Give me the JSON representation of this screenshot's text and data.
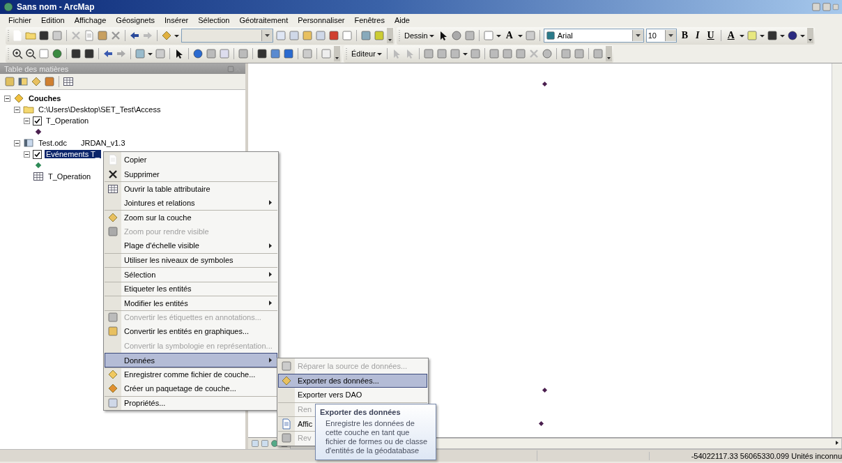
{
  "window": {
    "title": "Sans nom - ArcMap"
  },
  "menu_bar": [
    "Fichier",
    "Edition",
    "Affichage",
    "Géosignets",
    "Insérer",
    "Sélection",
    "Géotraitement",
    "Personnaliser",
    "Fenêtres",
    "Aide"
  ],
  "toolbar_1": {
    "drawing_button": "Dessin",
    "font": "Arial",
    "font_size": "10",
    "bold": "B",
    "italic": "I",
    "underline": "U",
    "font_color": "A",
    "text_tool": "A"
  },
  "toolbar_2": {
    "editor_button": "Éditeur"
  },
  "toc": {
    "title": "Table des matières",
    "tree": [
      {
        "label": "Couches",
        "kind": "frame",
        "expanded": true,
        "children": [
          {
            "label": "C:\\Users\\Desktop\\SET_Test\\Access",
            "kind": "folder",
            "expanded": true,
            "children": [
              {
                "label": "T_Operation",
                "kind": "layer",
                "expanded": true,
                "checked": true,
                "selected": false,
                "children": [
                  {
                    "kind": "symbol",
                    "color": "#4b1f4f"
                  }
                ]
              }
            ]
          },
          {
            "label": "Test.odc",
            "note": "JRDAN_v1.3",
            "kind": "database",
            "expanded": true,
            "children": [
              {
                "label": "Evénements T_",
                "kind": "layer",
                "expanded": true,
                "checked": true,
                "selected": true,
                "children": [
                  {
                    "kind": "symbol",
                    "color": "#2e8b57"
                  }
                ]
              },
              {
                "label": "T_Operation",
                "kind": "table"
              }
            ]
          }
        ]
      }
    ]
  },
  "context_menu": [
    {
      "label": "Copier",
      "disabled": false,
      "submenu": false,
      "selected": false,
      "separator_before": false
    },
    {
      "label": "Supprimer",
      "disabled": false,
      "submenu": false,
      "selected": false,
      "separator_before": false
    },
    {
      "label": "Ouvrir la table attributaire",
      "disabled": false,
      "submenu": false,
      "selected": false,
      "separator_before": true
    },
    {
      "label": "Jointures et relations",
      "disabled": false,
      "submenu": true,
      "selected": false,
      "separator_before": false
    },
    {
      "label": "Zoom sur la couche",
      "disabled": false,
      "submenu": false,
      "selected": false,
      "separator_before": true
    },
    {
      "label": "Zoom pour rendre visible",
      "disabled": true,
      "submenu": false,
      "selected": false,
      "separator_before": false
    },
    {
      "label": "Plage d'échelle visible",
      "disabled": false,
      "submenu": true,
      "selected": false,
      "separator_before": false
    },
    {
      "label": "Utiliser les niveaux de symboles",
      "disabled": false,
      "submenu": false,
      "selected": false,
      "separator_before": true
    },
    {
      "label": "Sélection",
      "disabled": false,
      "submenu": true,
      "selected": false,
      "separator_before": true
    },
    {
      "label": "Etiqueter les entités",
      "disabled": false,
      "submenu": false,
      "selected": false,
      "separator_before": true
    },
    {
      "label": "Modifier les entités",
      "disabled": false,
      "submenu": true,
      "selected": false,
      "separator_before": true
    },
    {
      "label": "Convertir les étiquettes en annotations...",
      "disabled": true,
      "submenu": false,
      "selected": false,
      "separator_before": true
    },
    {
      "label": "Convertir les entités en graphiques...",
      "disabled": false,
      "submenu": false,
      "selected": false,
      "separator_before": false
    },
    {
      "label": "Convertir la symbologie en représentation...",
      "disabled": true,
      "submenu": false,
      "selected": false,
      "separator_before": false
    },
    {
      "label": "Données",
      "disabled": false,
      "submenu": true,
      "selected": true,
      "separator_before": true
    },
    {
      "label": "Enregistrer comme fichier de couche...",
      "disabled": false,
      "submenu": false,
      "selected": false,
      "separator_before": true
    },
    {
      "label": "Créer un paquetage de couche...",
      "disabled": false,
      "submenu": false,
      "selected": false,
      "separator_before": false
    },
    {
      "label": "Propriétés...",
      "disabled": false,
      "submenu": false,
      "selected": false,
      "separator_before": true
    }
  ],
  "submenu": [
    {
      "label": "Réparer la source de données...",
      "disabled": true,
      "selected": false,
      "separator_before": false
    },
    {
      "label": "Exporter des données...",
      "disabled": false,
      "selected": true,
      "separator_before": false
    },
    {
      "label": "Exporter vers DAO",
      "disabled": false,
      "selected": false,
      "separator_before": false
    },
    {
      "label": "Ren",
      "disabled": true,
      "selected": false,
      "separator_before": true
    },
    {
      "label": "Affic",
      "disabled": false,
      "selected": false,
      "separator_before": true
    },
    {
      "label": "Rev",
      "disabled": true,
      "selected": false,
      "separator_before": true
    }
  ],
  "tooltip": {
    "title": "Exporter des données",
    "body": "Enregistre les données de cette couche en tant que fichier de formes ou de classe d'entités de la géodatabase"
  },
  "status_bar": {
    "coordinates": "-54022117.33  56065330.099 Unités inconnu"
  }
}
